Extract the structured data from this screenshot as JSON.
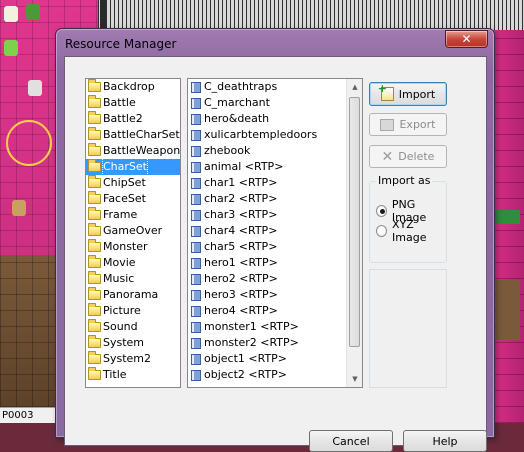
{
  "background": {
    "status_text": "P0003"
  },
  "dialog": {
    "title": "Resource Manager",
    "close_glyph": "✕"
  },
  "folders": {
    "items": [
      "Backdrop",
      "Battle",
      "Battle2",
      "BattleCharSet",
      "BattleWeapon",
      "CharSet",
      "ChipSet",
      "FaceSet",
      "Frame",
      "GameOver",
      "Monster",
      "Movie",
      "Music",
      "Panorama",
      "Picture",
      "Sound",
      "System",
      "System2",
      "Title"
    ],
    "selected": "CharSet"
  },
  "files": {
    "items": [
      "C_deathtraps",
      "C_marchant",
      "hero&death",
      "xulicarbtempledoors",
      "zhebook",
      "animal <RTP>",
      "char1 <RTP>",
      "char2 <RTP>",
      "char3 <RTP>",
      "char4 <RTP>",
      "char5 <RTP>",
      "hero1 <RTP>",
      "hero2 <RTP>",
      "hero3 <RTP>",
      "hero4 <RTP>",
      "monster1 <RTP>",
      "monster2 <RTP>",
      "object1 <RTP>",
      "object2 <RTP>"
    ]
  },
  "actions": {
    "import_label": "Import",
    "export_label": "Export",
    "delete_label": "Delete",
    "import_icon": "import-icon",
    "export_icon": "export-icon",
    "delete_icon": "delete-x-icon"
  },
  "import_as": {
    "label": "Import as",
    "options": [
      "PNG Image",
      "XYZ Image"
    ],
    "selected": "PNG Image"
  },
  "footer": {
    "cancel_label": "Cancel",
    "help_label": "Help"
  },
  "colors": {
    "selection": "#3399ff",
    "titlebar": "#8c6aa1",
    "close_button": "#c8463a"
  }
}
